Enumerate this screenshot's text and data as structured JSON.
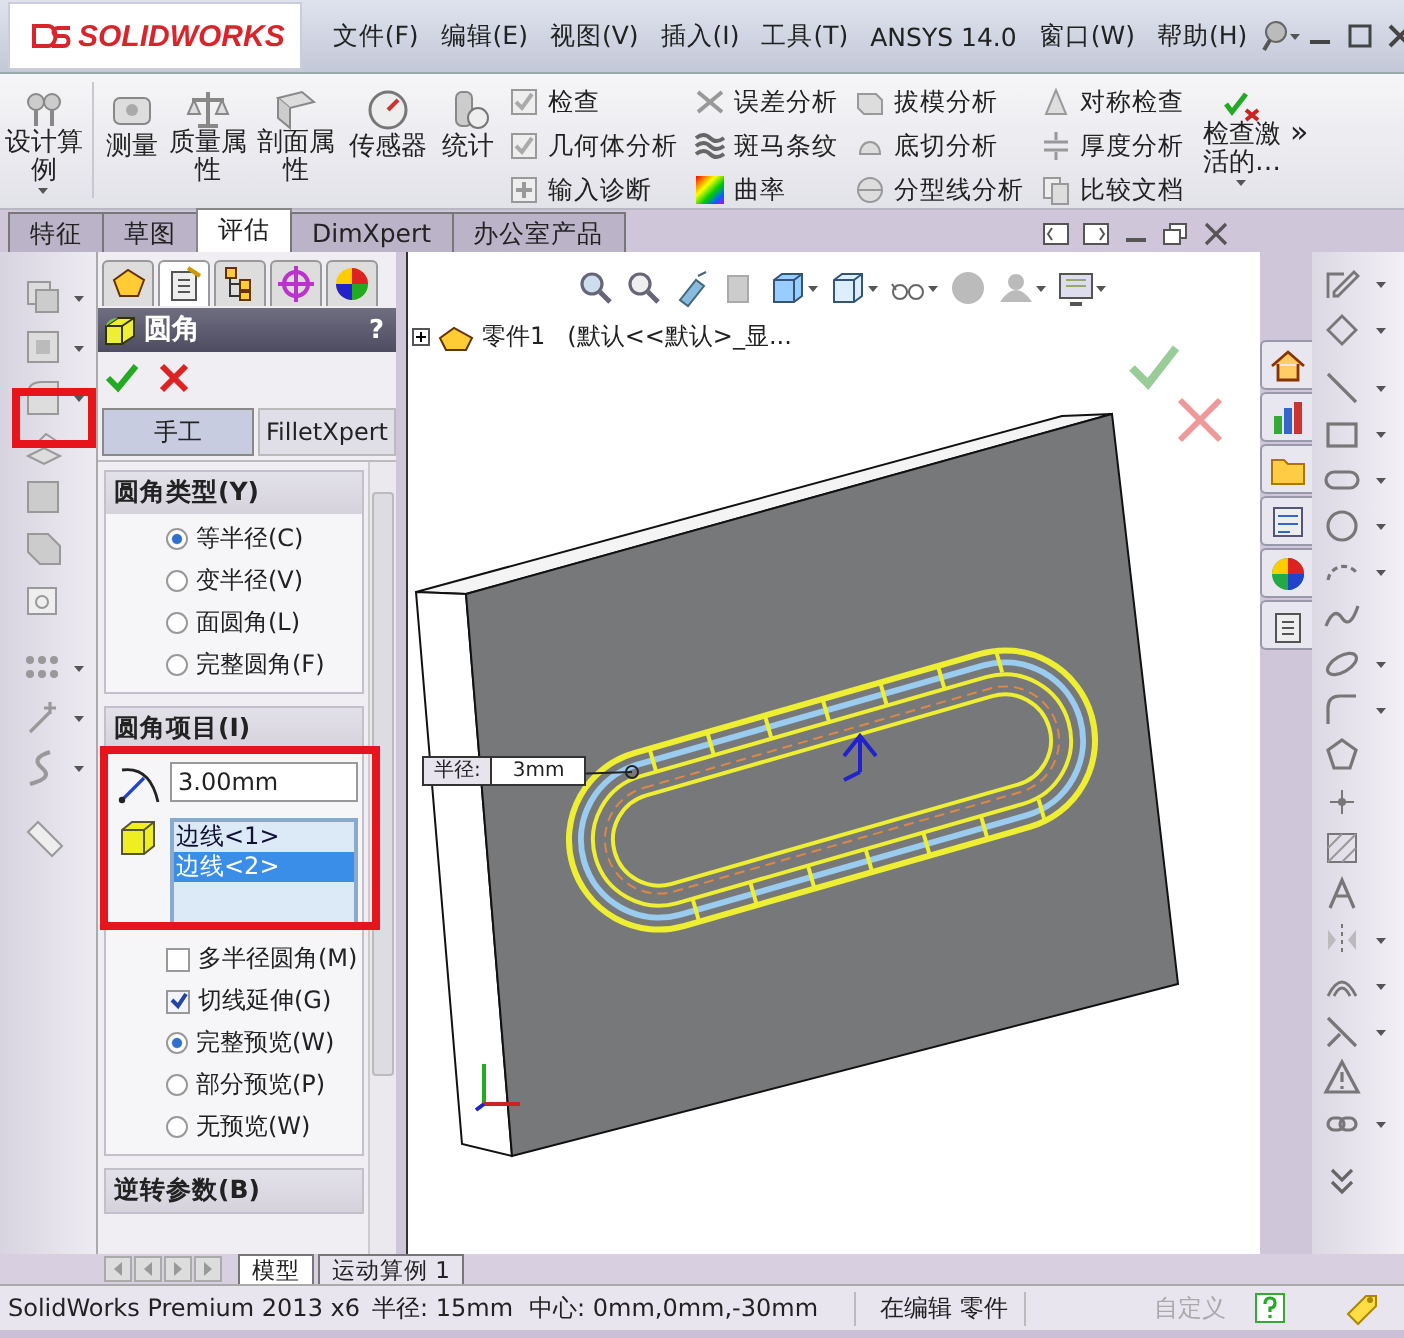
{
  "title_bar": {
    "logo": "SOLIDWORKS",
    "menu": [
      "文件(F)",
      "编辑(E)",
      "视图(V)",
      "插入(I)",
      "工具(T)",
      "ANSYS 14.0",
      "窗口(W)",
      "帮助(H)"
    ]
  },
  "ribbon": {
    "large_buttons": [
      {
        "label": "设计算例",
        "dropdown": true
      },
      {
        "label": "测量",
        "dropdown": false
      },
      {
        "label": "质量属性",
        "dropdown": false
      },
      {
        "label": "剖面属性",
        "dropdown": false
      },
      {
        "label": "传感器",
        "dropdown": false
      },
      {
        "label": "统计",
        "dropdown": false
      }
    ],
    "small_groups": [
      [
        "检查",
        "几何体分析",
        "输入诊断"
      ],
      [
        "误差分析",
        "斑马条纹",
        "曲率"
      ],
      [
        "拔模分析",
        "底切分析",
        "分型线分析"
      ],
      [
        "对称检查",
        "厚度分析",
        "比较文档"
      ]
    ],
    "end_button": {
      "label": "检查激活的…",
      "dropdown": true
    },
    "overflow": "»"
  },
  "command_tabs": [
    {
      "label": "特征",
      "selected": false
    },
    {
      "label": "草图",
      "selected": false
    },
    {
      "label": "评估",
      "selected": true
    },
    {
      "label": "DimXpert",
      "selected": false
    },
    {
      "label": "办公室产品",
      "selected": false
    }
  ],
  "property_manager": {
    "panel_tabs": [
      {
        "selected": false
      },
      {
        "selected": true
      },
      {
        "selected": false
      },
      {
        "selected": false
      },
      {
        "selected": false
      }
    ],
    "title": "圆角",
    "help": "?",
    "modes": [
      {
        "label": "手工",
        "selected": true
      },
      {
        "label": "FilletXpert",
        "selected": false
      }
    ],
    "groups": [
      {
        "kind": "options",
        "title": "圆角类型(Y)",
        "options": [
          {
            "kind": "radio",
            "label": "等半径(C)",
            "selected": true
          },
          {
            "kind": "radio",
            "label": "变半径(V)",
            "selected": false
          },
          {
            "kind": "radio",
            "label": "面圆角(L)",
            "selected": false
          },
          {
            "kind": "radio",
            "label": "完整圆角(F)",
            "selected": false
          }
        ]
      },
      {
        "kind": "items",
        "title": "圆角项目(I)",
        "radius": "3.00mm",
        "edges": [
          {
            "label": "边线<1>",
            "selected": false
          },
          {
            "label": "边线<2>",
            "selected": true
          }
        ],
        "options": [
          {
            "kind": "checkbox",
            "label": "多半径圆角(M)",
            "checked": false
          },
          {
            "kind": "checkbox",
            "label": "切线延伸(G)",
            "checked": true
          },
          {
            "kind": "radio",
            "label": "完整预览(W)",
            "selected": true
          },
          {
            "kind": "radio",
            "label": "部分预览(P)",
            "selected": false
          },
          {
            "kind": "radio",
            "label": "无预览(W)",
            "selected": false
          }
        ]
      },
      {
        "kind": "collapsed",
        "title": "逆转参数(B)"
      }
    ]
  },
  "viewport": {
    "tree_root": "零件1",
    "tree_config": "(默认<<默认>_显...",
    "callout": {
      "label": "半径:",
      "value": "3mm"
    }
  },
  "bottom_tabs": [
    {
      "label": "模型",
      "selected": true
    },
    {
      "label": "运动算例 1",
      "selected": false
    }
  ],
  "status_bar": {
    "product": "SolidWorks Premium 2013 x6",
    "radius": "半径: 15mm",
    "center": "中心: 0mm,0mm,-30mm",
    "mode": "在编辑 零件",
    "customize": "自定义"
  }
}
